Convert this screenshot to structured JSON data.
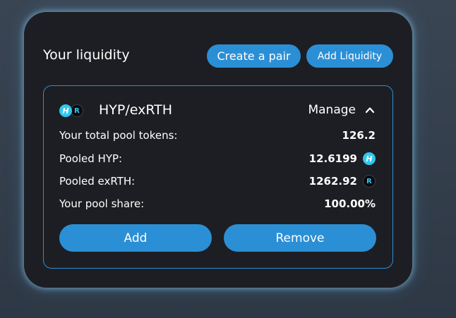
{
  "header": {
    "title": "Your liquidity",
    "create_pair_label": "Create a pair",
    "add_liquidity_label": "Add Liquidity"
  },
  "position": {
    "pair_name": "HYP/exRTH",
    "token_a_icon": "hyp-token-icon",
    "token_b_icon": "exrth-token-icon",
    "manage_label": "Manage",
    "manage_icon": "chevron-up-icon",
    "rows": [
      {
        "label": "Your total pool tokens:",
        "value": "126.2"
      },
      {
        "label": "Pooled HYP:",
        "value": "12.6199",
        "icon": "hyp-token-icon"
      },
      {
        "label": "Pooled exRTH:",
        "value": "1262.92",
        "icon": "exrth-token-icon"
      },
      {
        "label": "Your pool share:",
        "value": "100.00%"
      }
    ],
    "add_label": "Add",
    "remove_label": "Remove"
  },
  "colors": {
    "accent": "#2b8fd6",
    "panel_bg": "#1d1e23",
    "page_bg": "#343f4c",
    "hyp_token": "#2ec8f0",
    "exrth_token": "#0a0a0c"
  }
}
